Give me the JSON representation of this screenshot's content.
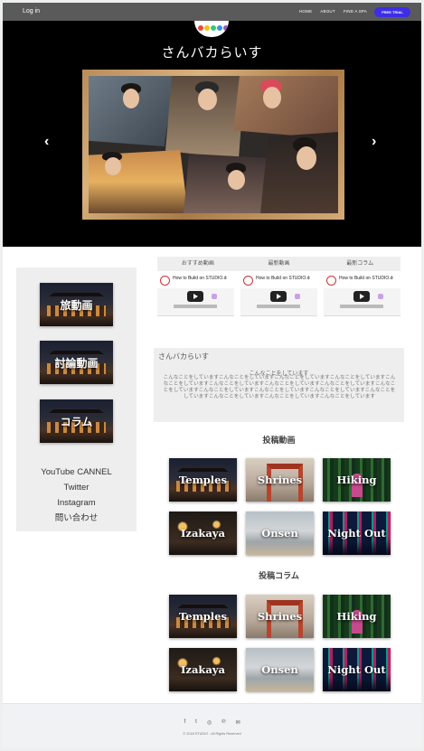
{
  "nav": {
    "login": "Log in",
    "links": [
      "HOME",
      "ABOUT",
      "FIND A SPA"
    ],
    "cta": "FREE TRIAL"
  },
  "hero": {
    "site_title": "さんバカらいす",
    "prev_arrow": "‹",
    "next_arrow": "›"
  },
  "sidebar": {
    "categories": [
      "旅動画",
      "討論動画",
      "コラム"
    ],
    "links": [
      "YouTube CANNEL",
      "Twitter",
      "Instagram",
      "問い合わせ"
    ]
  },
  "tabs": [
    "おすすめ動画",
    "最新動画",
    "最新コラム"
  ],
  "videos": [
    {
      "title": "How to Build on STUDIO.design"
    },
    {
      "title": "How to Build on STUDIO.design"
    },
    {
      "title": "How to Build on STUDIO.design"
    }
  ],
  "intro": {
    "title": "さんバカらいす",
    "heading": "こんなことをしています",
    "body": "こんなことをしていますこんなことをしていますこんなことをしていますこんなことをしていますこんなことをしていますこんなことをしていますこんなことをしていますこんなことをしていますこんなことをしていますこんなことをしていますこんなことをしていますこんなことをしていますこんなことをしていますこんなことをしていますこんなことをしていますこんなことをしています"
  },
  "posted_videos": {
    "title": "投稿動画",
    "items": [
      "Temples",
      "Shrines",
      "Hiking",
      "Izakaya",
      "Onsen",
      "Night Out"
    ]
  },
  "posted_columns": {
    "title": "投稿コラム",
    "items": [
      "Temples",
      "Shrines",
      "Hiking",
      "Izakaya",
      "Onsen",
      "Night Out"
    ]
  },
  "footer": {
    "social_icons": [
      "facebook-icon",
      "twitter-icon",
      "instagram-icon",
      "pinterest-icon",
      "email-icon"
    ],
    "social_glyphs": [
      "f",
      "t",
      "◎",
      "℗",
      "✉"
    ],
    "copyright": "© 2018 STUDIO - All Rights Reserved"
  },
  "colors": {
    "accent": "#3d2ee6",
    "hero_bg": "#000000",
    "panel_bg": "#eeeeee"
  }
}
